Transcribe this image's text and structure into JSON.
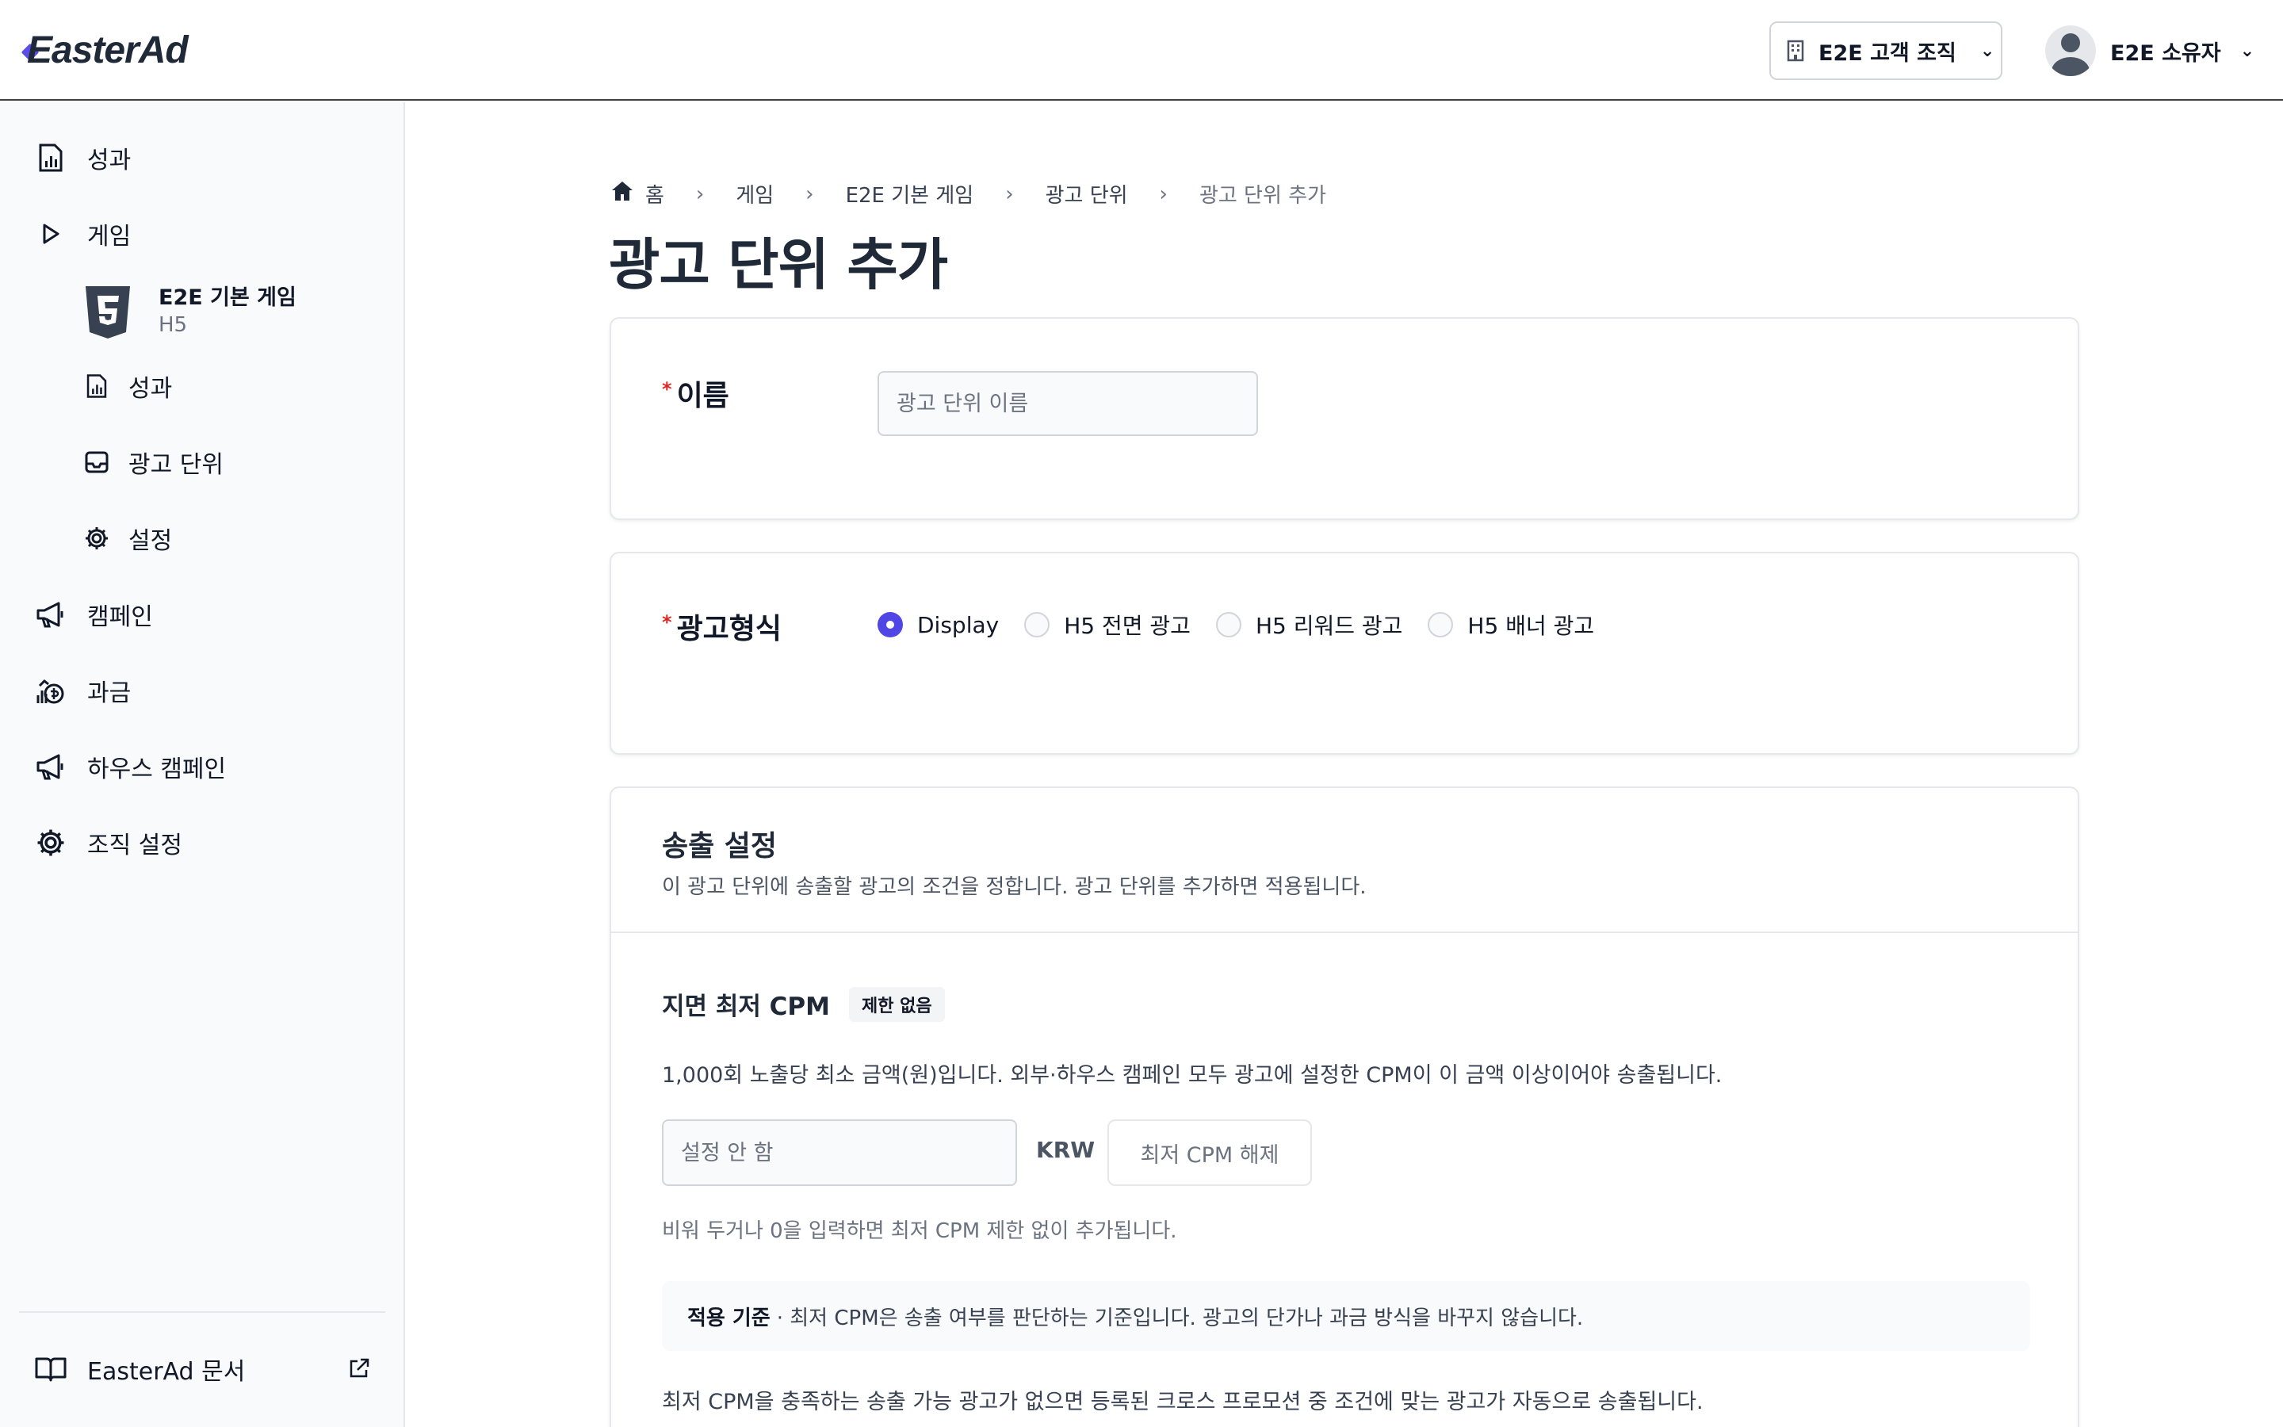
{
  "header": {
    "logo": "EasterAd",
    "org": "E2E 고객 조직",
    "user": "E2E 소유자"
  },
  "sidebar": {
    "items": [
      {
        "label": "성과",
        "icon": "report-icon"
      },
      {
        "label": "게임",
        "icon": "play-icon"
      },
      {
        "label": "캠페인",
        "icon": "megaphone-icon"
      },
      {
        "label": "과금",
        "icon": "coins-icon"
      },
      {
        "label": "하우스 캠페인",
        "icon": "megaphone-icon"
      },
      {
        "label": "조직 설정",
        "icon": "gear-icon"
      }
    ],
    "game": {
      "name": "E2E 기본 게임",
      "platform": "H5"
    },
    "sub_items": [
      {
        "label": "성과",
        "icon": "report-icon"
      },
      {
        "label": "광고 단위",
        "icon": "inbox-icon"
      },
      {
        "label": "설정",
        "icon": "gear-icon"
      }
    ],
    "docs": "EasterAd 문서"
  },
  "breadcrumb": [
    "홈",
    "게임",
    "E2E 기본 게임",
    "광고 단위",
    "광고 단위 추가"
  ],
  "page_title": "광고 단위 추가",
  "name_card": {
    "required": "*",
    "label": "이름",
    "placeholder": "광고 단위 이름"
  },
  "format_card": {
    "required": "*",
    "label": "광고형식",
    "options": [
      "Display",
      "H5 전면 광고",
      "H5 리워드 광고",
      "H5 배너 광고"
    ],
    "selected": "Display"
  },
  "delivery": {
    "title": "송출 설정",
    "desc": "이 광고 단위에 송출할 광고의 조건을 정합니다. 광고 단위를 추가하면 적용됩니다.",
    "cpm_title": "지면 최저 CPM",
    "cpm_badge": "제한 없음",
    "cpm_desc": "1,000회 노출당 최소 금액(원)입니다. 외부·하우스 캠페인 모두 광고에 설정한 CPM이 이 금액 이상이어야 송출됩니다.",
    "cpm_placeholder": "설정 안 함",
    "currency": "KRW",
    "clear_button": "최저 CPM 해제",
    "hint": "비워 두거나 0을 입력하면 최저 CPM 제한 없이 추가됩니다.",
    "info_label": "적용 기준",
    "info_text": "· 최저 CPM은 송출 여부를 판단하는 기준입니다. 광고의 단가나 과금 방식을 바꾸지 않습니다.",
    "footer_text": "최저 CPM을 충족하는 송출 가능 광고가 없으면 등록된 크로스 프로모션 중 조건에 맞는 광고가 자동으로 송출됩니다."
  },
  "colors": {
    "accent": "#4f46e5",
    "required": "#dc2626",
    "sidebar_bg": "#f9fafb"
  }
}
